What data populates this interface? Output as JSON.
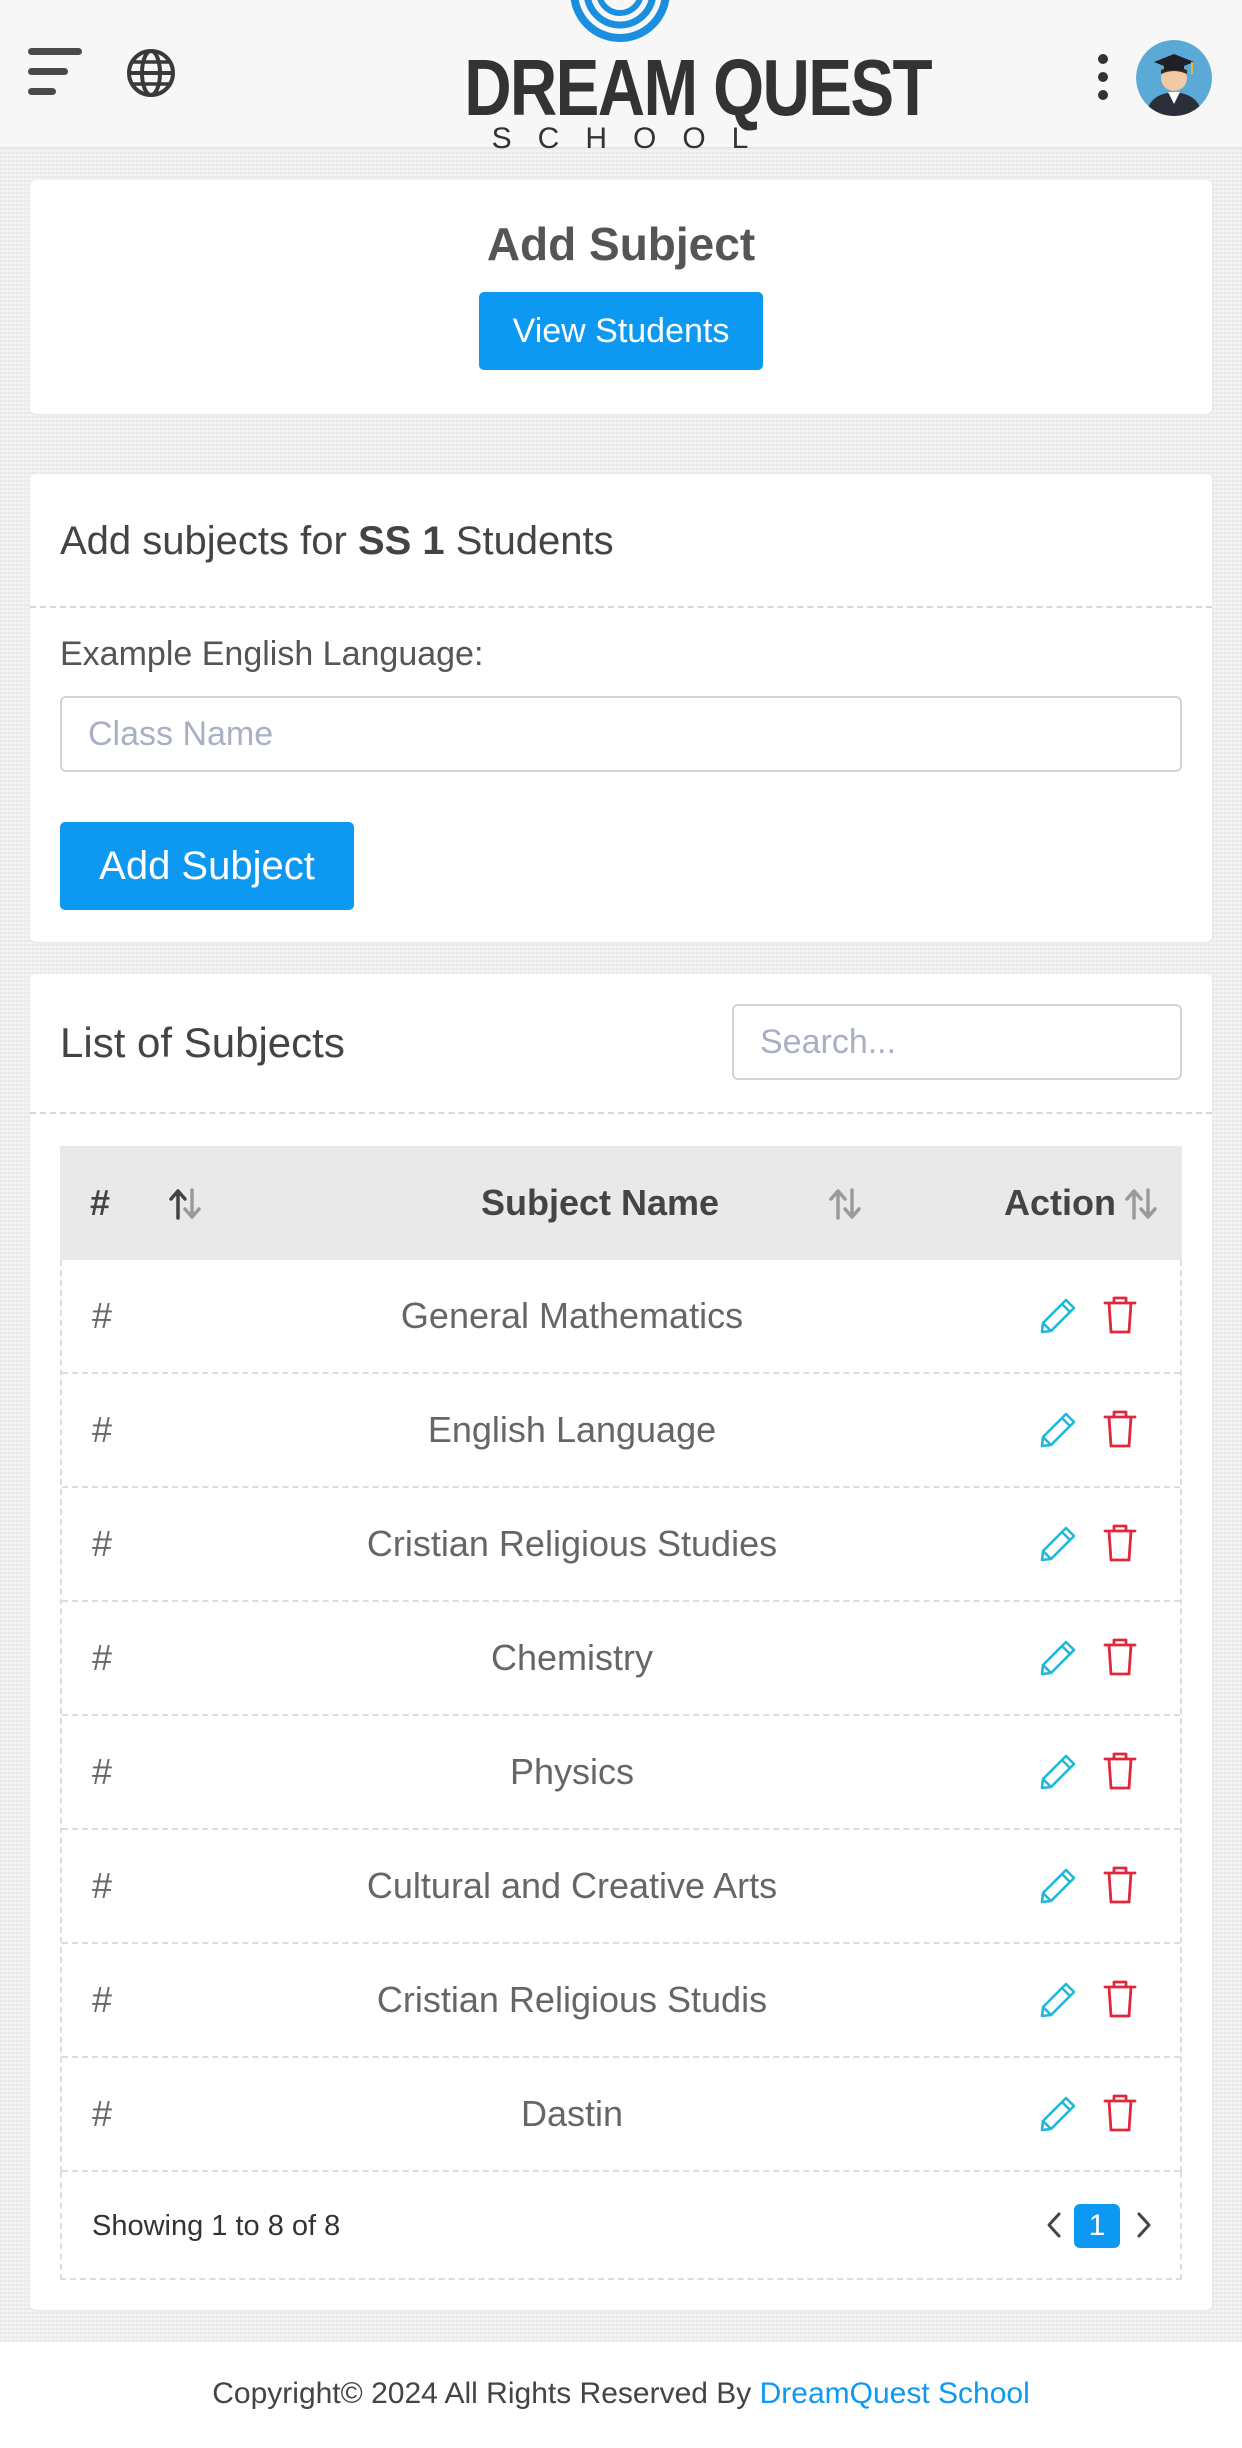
{
  "header": {
    "brand_title": "DREAM QUEST",
    "brand_subtitle": "SCHOOL"
  },
  "add_card": {
    "title": "Add Subject",
    "view_students_label": "View Students"
  },
  "form_card": {
    "heading_prefix": "Add subjects for ",
    "heading_class": "SS 1",
    "heading_suffix": " Students",
    "example_label": "Example English Language:",
    "input_placeholder": "Class Name",
    "input_value": "",
    "submit_label": "Add Subject"
  },
  "list_card": {
    "heading": "List of Subjects",
    "search_placeholder": "Search...",
    "columns": {
      "hash": "#",
      "name": "Subject Name",
      "action": "Action"
    },
    "rows": [
      {
        "hash": "#",
        "name": "General Mathematics"
      },
      {
        "hash": "#",
        "name": "English Language"
      },
      {
        "hash": "#",
        "name": "Cristian Religious Studies"
      },
      {
        "hash": "#",
        "name": "Chemistry"
      },
      {
        "hash": "#",
        "name": "Physics"
      },
      {
        "hash": "#",
        "name": "Cultural and Creative Arts"
      },
      {
        "hash": "#",
        "name": "Cristian Religious Studis"
      },
      {
        "hash": "#",
        "name": "Dastin"
      }
    ],
    "showing_text": "Showing 1 to 8 of 8",
    "current_page": "1"
  },
  "footer": {
    "copyright_text": "Copyright© 2024 All Rights Reserved By ",
    "link_text": "DreamQuest School"
  },
  "colors": {
    "primary": "#0d99f2",
    "edit_icon": "#1fb8d8",
    "delete_icon": "#e0283c"
  },
  "icons": {
    "menu": "hamburger-menu-icon",
    "language": "globe-icon",
    "more": "vertical-dots-icon",
    "sort": "sort-arrows-icon",
    "edit": "pencil-icon",
    "delete": "trash-icon",
    "prev": "chevron-left-icon",
    "next": "chevron-right-icon"
  }
}
